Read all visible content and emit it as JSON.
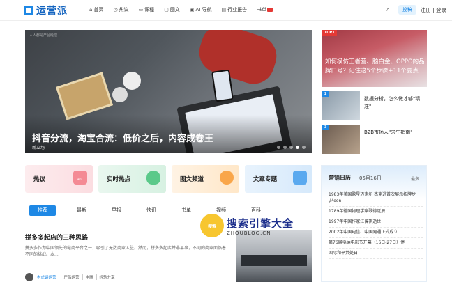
{
  "header": {
    "logo_text": "运营派",
    "logo_sub": "YUNYINGPAI.COM",
    "nav": [
      {
        "icon": "⌂",
        "label": "首页"
      },
      {
        "icon": "◷",
        "label": "热议"
      },
      {
        "icon": "▭",
        "label": "课程"
      },
      {
        "icon": "▢",
        "label": "图文"
      },
      {
        "icon": "▣",
        "label": "AI 导航"
      },
      {
        "icon": "▤",
        "label": "行业报告"
      },
      {
        "icon": "",
        "label": "书单"
      }
    ],
    "post_label": "投稿",
    "auth_label": "注册 | 登录"
  },
  "hero": {
    "watermark": "人人都是产品经理",
    "title": "抖音分流，淘宝合流：低价之后，内容成卷王",
    "category": "新立场"
  },
  "top_list": {
    "tag": "TOP1",
    "title1": "如何模仿王者营、脑白金、OPPO的品牌口号？记住这5个步骤+11个要点",
    "items": [
      {
        "rank": "2",
        "title": "数据分析，怎么做才够\"精准\""
      },
      {
        "rank": "3",
        "title": "B2B市场人\"求生指南\""
      }
    ]
  },
  "categories": [
    {
      "label": "热议",
      "badge": "HOT"
    },
    {
      "label": "实时热点",
      "badge": ""
    },
    {
      "label": "图文频道",
      "badge": ""
    },
    {
      "label": "文章专题",
      "badge": ""
    }
  ],
  "tabs": [
    "推荐",
    "最新",
    "早报",
    "快讯",
    "书单",
    "视频",
    "百科"
  ],
  "article": {
    "title": "拼多多起店的三种思路",
    "desc": "拼多多作为中国领先的电商平台之一，吸引了无数商家入驻。然而，拼多多起店并非易事，不同的商家面临着不同的挑战。本...",
    "author": "老虎讲运营",
    "tags": [
      "产品运营",
      "电商",
      "经验分享"
    ]
  },
  "watermark": {
    "logo": "搜索",
    "main": "搜索引擎大全",
    "sub": "ZHOUBLOG.CN"
  },
  "calendar": {
    "title": "营销日历",
    "date": "05月16日",
    "more": "最多",
    "items": [
      "1983年美国歌星迈克尔·杰克逊首次展示招牌步\\Moon",
      "1789年德国物理学家歌德诞辰",
      "1997年中国作家汪曾祺逝世",
      "2002年中国电信、中国网通正式成立",
      "第76届戛纳电影节开幕（16日-27日）停",
      "国际和平共处日"
    ]
  }
}
